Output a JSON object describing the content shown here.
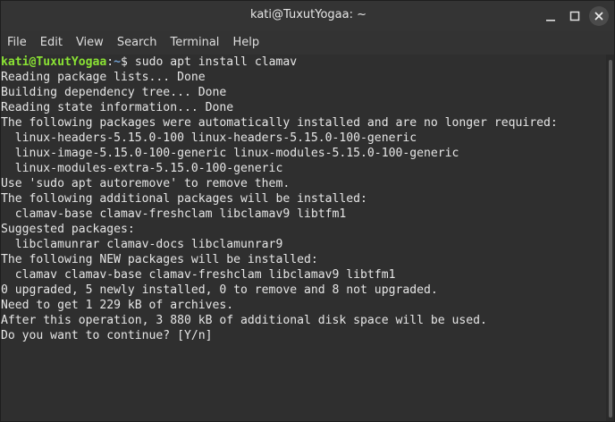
{
  "window": {
    "title": "kati@TuxutYogaa: ~"
  },
  "menu": {
    "items": [
      "File",
      "Edit",
      "View",
      "Search",
      "Terminal",
      "Help"
    ]
  },
  "terminal": {
    "prompt": {
      "user_host": "kati@TuxutYogaa",
      "separator": ":",
      "path": "~",
      "symbol": "$ ",
      "command": "sudo apt install clamav"
    },
    "output": [
      "Reading package lists... Done",
      "Building dependency tree... Done",
      "Reading state information... Done",
      "The following packages were automatically installed and are no longer required:",
      "  linux-headers-5.15.0-100 linux-headers-5.15.0-100-generic",
      "  linux-image-5.15.0-100-generic linux-modules-5.15.0-100-generic",
      "  linux-modules-extra-5.15.0-100-generic",
      "Use 'sudo apt autoremove' to remove them.",
      "The following additional packages will be installed:",
      "  clamav-base clamav-freshclam libclamav9 libtfm1",
      "Suggested packages:",
      "  libclamunrar clamav-docs libclamunrar9",
      "The following NEW packages will be installed:",
      "  clamav clamav-base clamav-freshclam libclamav9 libtfm1",
      "0 upgraded, 5 newly installed, 0 to remove and 8 not upgraded.",
      "Need to get 1 229 kB of archives.",
      "After this operation, 3 880 kB of additional disk space will be used.",
      "Do you want to continue? [Y/n] "
    ]
  },
  "colors": {
    "background": "#2f2f2f",
    "text": "#e6e6e6",
    "prompt_user": "#8ae234",
    "prompt_path": "#729fcf"
  },
  "icons": {
    "minimize": "minimize-icon",
    "maximize": "maximize-icon",
    "close": "close-icon"
  }
}
